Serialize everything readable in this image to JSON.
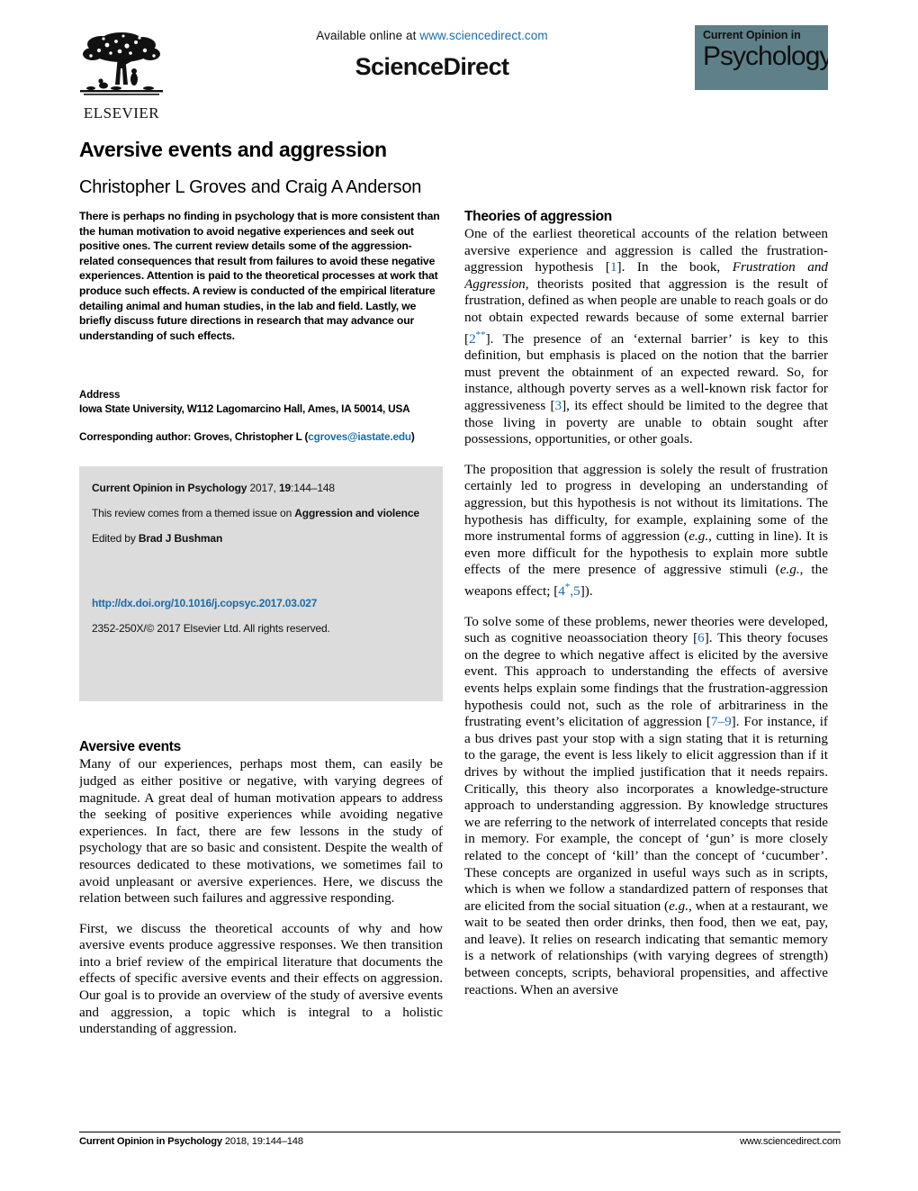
{
  "masthead": {
    "available_online_prefix": "Available online at ",
    "sciencedirect_url": "www.sciencedirect.com",
    "sciencedirect_wordmark": "ScienceDirect",
    "publisher_name": "ELSEVIER",
    "journal_logo_top": "Current Opinion in",
    "journal_logo_main": "Psychology",
    "journal_logo_bg": "#5f8089",
    "link_color": "#1b6ca8"
  },
  "article": {
    "title": "Aversive events and aggression",
    "authors": "Christopher L Groves and Craig A Anderson"
  },
  "abstract": {
    "text": "There is perhaps no finding in psychology that is more consistent than the human motivation to avoid negative experiences and seek out positive ones. The current review details some of the aggression-related consequences that result from failures to avoid these negative experiences. Attention is paid to the theoretical processes at work that produce such effects. A review is conducted of the empirical literature detailing animal and human studies, in the lab and field. Lastly, we briefly discuss future directions in research that may advance our understanding of such effects."
  },
  "address": {
    "heading": "Address",
    "affiliation": "Iowa State University, W112 Lagomarcino Hall, Ames, IA 50014, USA",
    "corresponding_prefix": "Corresponding author: Groves, Christopher L (",
    "corresponding_email": "cgroves@iastate.edu",
    "corresponding_suffix": ")"
  },
  "infobox": {
    "journal_name": "Current Opinion in Psychology",
    "journal_year": " 2017, ",
    "volume": "19",
    "pages": ":144–148",
    "themed_issue_prefix": "This review comes from a themed issue on ",
    "themed_issue_topic": "Aggression and violence",
    "edited_by_prefix": "Edited by ",
    "editor": "Brad J Bushman",
    "doi": "http://dx.doi.org/10.1016/j.copsyc.2017.03.027",
    "rights": "2352-250X/© 2017 Elsevier Ltd. All rights reserved."
  },
  "left_column": {
    "section_heading": "Aversive events",
    "paragraphs": [
      "Many of our experiences, perhaps most them, can easily be judged as either positive or negative, with varying degrees of magnitude. A great deal of human motivation appears to address the seeking of positive experiences while avoiding negative experiences. In fact, there are few lessons in the study of psychology that are so basic and consistent. Despite the wealth of resources dedicated to these motivations, we sometimes fail to avoid unpleasant or aversive experiences. Here, we discuss the relation between such failures and aggressive responding.",
      "First, we discuss the theoretical accounts of why and how aversive events produce aggressive responses. We then transition into a brief review of the empirical literature that documents the effects of specific aversive events and their effects on aggression. Our goal is to provide an overview of the study of aversive events and aggression, a topic which is integral to a holistic understanding of aggression."
    ]
  },
  "right_column": {
    "section_heading": "Theories of aggression",
    "paragraph1": {
      "part1": "One of the earliest theoretical accounts of the relation between aversive experience and aggression is called the frustration-aggression hypothesis [",
      "ref1": "1",
      "part2": "]. In the book, ",
      "italic1": "Frustration and Aggression",
      "part3": ", theorists posited that aggression is the result of frustration, defined as when people are unable to reach goals or do not obtain expected rewards because of some external barrier [",
      "ref2": "2",
      "ref2_marks": "**",
      "part4": "]. The presence of an ‘external barrier’ is key to this definition, but emphasis is placed on the notion that the barrier must prevent the obtainment of an expected reward. So, for instance, although poverty serves as a well-known risk factor for aggressiveness [",
      "ref3": "3",
      "part5": "], its effect should be limited to the degree that those living in poverty are unable to obtain sought after possessions, opportunities, or other goals."
    },
    "paragraph2": {
      "part1": "The proposition that aggression is solely the result of frustration certainly led to progress in developing an understanding of aggression, but this hypothesis is not without its limitations. The hypothesis has difficulty, for example, explaining some of the more instrumental forms of aggression (",
      "italic1": "e.g.",
      "part2": ", cutting in line). It is even more difficult for the hypothesis to explain more subtle effects of the mere presence of aggressive stimuli (",
      "italic2": "e.g.",
      "part3": ", the weapons effect; [",
      "ref4": "4",
      "ref4_marks": "*",
      "ref5": ",5",
      "part4": "])."
    },
    "paragraph3": {
      "part1": "To solve some of these problems, newer theories were developed, such as cognitive neoassociation theory [",
      "ref6": "6",
      "part2": "]. This theory focuses on the degree to which negative affect is elicited by the aversive event. This approach to understanding the effects of aversive events helps explain some findings that the frustration-aggression hypothesis could not, such as the role of arbitrariness in the frustrating event’s elicitation of aggression [",
      "ref7": "7–9",
      "part3": "]. For instance, if a bus drives past your stop with a sign stating that it is returning to the garage, the event is less likely to elicit aggression than if it drives by without the implied justification that it needs repairs. Critically, this theory also incorporates a knowledge-structure approach to understanding aggression. By knowledge structures we are referring to the network of interrelated concepts that reside in memory. For example, the concept of ‘gun’ is more closely related to the concept of ‘kill’ than the concept of ‘cucumber’. These concepts are organized in useful ways such as in scripts, which is when we follow a standardized pattern of responses that are elicited from the social situation (",
      "italic1": "e.g.",
      "part4": ", when at a restaurant, we wait to be seated then order drinks, then food, then we eat, pay, and leave). It relies on research indicating that semantic memory is a network of relationships (with varying degrees of strength) between concepts, scripts, behavioral propensities, and affective reactions. When an aversive"
    }
  },
  "footer": {
    "journal_name": "Current Opinion in Psychology",
    "citation": " 2018, 19:144–148",
    "website": "www.sciencedirect.com"
  }
}
